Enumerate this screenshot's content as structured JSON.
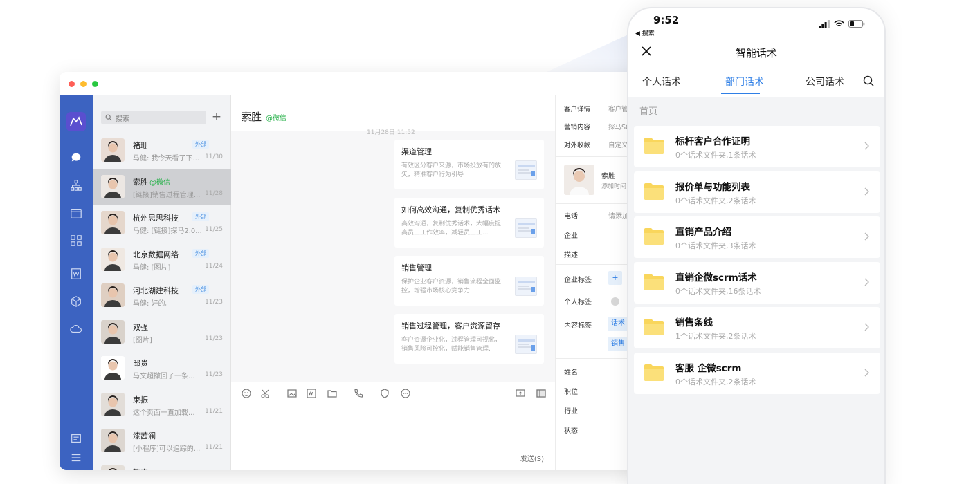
{
  "colors": {
    "rail": "#3c63c1",
    "accent": "#2f7fe6",
    "wechat_green": "#27b14a",
    "folder_yellow": "#f9d65c"
  },
  "desktop": {
    "search_placeholder": "搜索",
    "conversations": [
      {
        "name": "褚珊",
        "tag": "外部",
        "message": "马健: 我今天看了下...",
        "time": "11/30",
        "active": false,
        "wechat": ""
      },
      {
        "name": "索胜",
        "tag": "",
        "message": "[链接]销售过程管理...",
        "time": "11/28",
        "active": true,
        "wechat": "@微信"
      },
      {
        "name": "杭州思思科技",
        "tag": "外部",
        "message": "马健: [链接]探马2.0...",
        "time": "11/25",
        "active": false,
        "wechat": ""
      },
      {
        "name": "北京数据网络",
        "tag": "外部",
        "message": "马健: [图片]",
        "time": "11/24",
        "active": false,
        "wechat": ""
      },
      {
        "name": "河北湖建科技",
        "tag": "外部",
        "message": "马健: 好的。",
        "time": "11/23",
        "active": false,
        "wechat": ""
      },
      {
        "name": "双强",
        "tag": "",
        "message": "[图片]",
        "time": "11/23",
        "active": false,
        "wechat": ""
      },
      {
        "name": "邸贵",
        "tag": "",
        "message": "马文超撤回了一条...",
        "time": "11/23",
        "active": false,
        "wechat": ""
      },
      {
        "name": "束振",
        "tag": "",
        "message": "这个页面一直加载...",
        "time": "11/21",
        "active": false,
        "wechat": ""
      },
      {
        "name": "漆茜澜",
        "tag": "",
        "message": "[小程序]可以追踪的...",
        "time": "11/21",
        "active": false,
        "wechat": ""
      },
      {
        "name": "敬喜",
        "tag": "",
        "message": "",
        "time": "",
        "active": false,
        "wechat": ""
      }
    ],
    "chat": {
      "title": "索胜",
      "wechat": "@微信",
      "date_divider": "11月28日 11:52",
      "cards": [
        {
          "title": "渠道管理",
          "desc": "有效区分客户来源，市场投放有的放矢，精准客户行为引导"
        },
        {
          "title": "如何高效沟通，复制优秀话术",
          "desc": "高效沟通，复制优秀话术，大幅度提高员工工作效率，减轻员工工..."
        },
        {
          "title": "销售管理",
          "desc": "保护企业客户资源，销售流程全面监控，增强市场核心竞争力"
        },
        {
          "title": "销售过程管理，客户资源留存",
          "desc": "客户资源企业化，过程管理可视化，销售风险可控化，赋能销售管理."
        }
      ],
      "send_label": "发送(S)"
    },
    "info": {
      "tabs": [
        "客户详情",
        "客户管",
        "营销内容",
        "探马SC",
        "对外收款",
        "自定义"
      ],
      "contact_name": "索胜",
      "contact_sub": "添加时间",
      "phone_label": "电话",
      "phone_value": "请添加",
      "company_label": "企业",
      "desc_label": "描述",
      "corp_tag_label": "企业标签",
      "corp_tag_add": "+",
      "personal_tag_label": "个人标签",
      "content_tag_label": "内容标签",
      "content_tags": [
        "话术",
        "销售"
      ],
      "name_label": "姓名",
      "title_label": "职位",
      "industry_label": "行业",
      "status_label": "状态"
    }
  },
  "phone": {
    "time": "9:52",
    "back_label": "◀ 搜索",
    "title": "智能话术",
    "tabs": [
      "个人话术",
      "部门话术",
      "公司话术"
    ],
    "active_tab": 1,
    "breadcrumb": "首页",
    "folders": [
      {
        "name": "标杆客户合作证明",
        "stats": "0个话术文件夹,1条话术"
      },
      {
        "name": "报价单与功能列表",
        "stats": "0个话术文件夹,2条话术"
      },
      {
        "name": "直销产品介绍",
        "stats": "0个话术文件夹,3条话术"
      },
      {
        "name": "直销企微scrm话术",
        "stats": "0个话术文件夹,16条话术"
      },
      {
        "name": "销售条线",
        "stats": "1个话术文件夹,2条话术"
      },
      {
        "name": "客服 企微scrm",
        "stats": "0个话术文件夹,2条话术"
      }
    ]
  }
}
